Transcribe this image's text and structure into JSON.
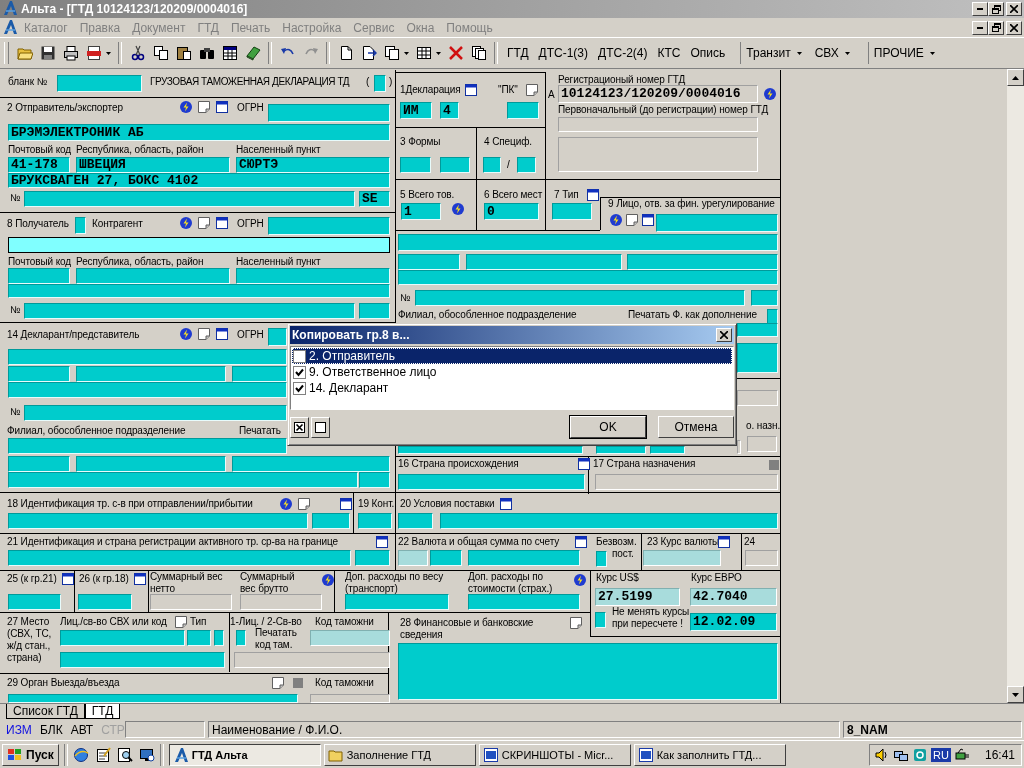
{
  "window": {
    "title": "Альта - [ГТД 10124123/120209/0004016]"
  },
  "menu": [
    {
      "label": "Каталог",
      "disabled": true
    },
    {
      "label": "Правка",
      "disabled": true
    },
    {
      "label": "Документ",
      "disabled": true
    },
    {
      "label": "ГТД",
      "disabled": true
    },
    {
      "label": "Печать",
      "disabled": true
    },
    {
      "label": "Настройка",
      "disabled": true
    },
    {
      "label": "Сервис",
      "disabled": true
    },
    {
      "label": "Окна",
      "disabled": true
    },
    {
      "label": "Помощь",
      "disabled": true
    }
  ],
  "toolbar": {
    "buttons": [
      {
        "label": "ГТД",
        "dropdown": false
      },
      {
        "label": "ДТС-1(3)",
        "dropdown": false
      },
      {
        "label": "ДТС-2(4)",
        "dropdown": false
      },
      {
        "label": "КТС",
        "dropdown": false
      },
      {
        "label": "Опись",
        "dropdown": false
      },
      {
        "label": "Транзит",
        "dropdown": true
      },
      {
        "label": "СВХ",
        "dropdown": true
      },
      {
        "label": "ПРОЧИЕ",
        "dropdown": true
      }
    ]
  },
  "form": {
    "labels": [
      "бланк №",
      "ГРУЗОВАЯ ТАМОЖЕННАЯ ДЕКЛАРАЦИЯ  ТД",
      "(",
      ")",
      "2 Отправитель/экспортер",
      "ОГРН",
      "Почтовый код",
      "Республика, область, район",
      "Населенный пункт",
      "№",
      "8 Получатель",
      "Контрагент",
      "ОГРН",
      "Почтовый код",
      "Республика, область, район",
      "Населенный пункт",
      "№",
      "14 Декларант/представитель",
      "ОГРН",
      "№",
      "Филиал, обособленное подразделение",
      "Печатать",
      "18 Идентификация тр. с-в при отправлении/прибытии",
      "19 Конт.",
      "21 Идентификация и страна регистрации активного тр. ср-ва на границе",
      "25 (к гр.21)",
      "26 (к гр.18)",
      "Суммарный вес нетто",
      "Суммарный вес брутто",
      "Доп. расходы по весу (транспорт)",
      "Доп. расходы по стоимости (страх.)",
      "Курс US$",
      "Курс ЕВРО",
      "Не менять курсы при пересчете !",
      "27  Место (СВХ, ТС, ж/д стан., страна)",
      "Лиц./св-во СВХ или код",
      "Тип",
      "1-Лиц. / 2-Св-во",
      "Печатать код там.",
      "Код таможни",
      "28 Финансовые и банковские сведения",
      "29 Орган Выезда/въезда",
      "Код таможни",
      "1Декларация",
      "\"ПК\"",
      "А",
      "Регистрационый номер ГТД",
      "Первоначальный (до регистрации) номер ГТД",
      "3 Формы",
      "4 Специф.",
      "/",
      "5 Всего тов.",
      "6 Всего мест",
      "7 Тип",
      "9 Лицо, отв. за фин. урегулирование",
      "№",
      "Филиал, обособленное подразделение",
      "Печатать Ф. как дополнение",
      "о. назн.",
      "16 Страна происхождения",
      "17 Страна назначения",
      "20 Условия поставки",
      "22 Валюта и общая сумма по счету",
      "Безвозм.",
      "пост.",
      "23 Курс валюты",
      "24"
    ],
    "fields": [
      {
        "text": "10124123/120209/0004016",
        "focused": false
      },
      {
        "text": "БРЭМЭЛЕКТРОНИК АБ",
        "focused": false
      },
      {
        "text": "41-178",
        "focused": false
      },
      {
        "text": "ШВЕЦИЯ",
        "focused": false
      },
      {
        "text": "СЮРТЭ",
        "focused": false
      },
      {
        "text": "БРУКСВАГЕН 27, БОКС 4102",
        "focused": false
      },
      {
        "text": "SE",
        "focused": false
      },
      {
        "focused": true
      },
      {
        "text": "ИМ",
        "focused": false
      },
      {
        "text": "4",
        "focused": false
      },
      {
        "text": "1",
        "focused": false
      },
      {
        "text": "0",
        "focused": false
      },
      {
        "text": "27.5199",
        "focused": false
      },
      {
        "text": "42.7040",
        "focused": false
      },
      {
        "text": "12.02.09",
        "focused": false
      }
    ]
  },
  "dialog": {
    "title": "Копировать гр.8 в...",
    "items": [
      {
        "label": "2. Отправитель",
        "checked": false,
        "selected": true
      },
      {
        "label": "9. Ответственное лицо",
        "checked": true,
        "selected": false
      },
      {
        "label": "14. Декларант",
        "checked": true,
        "selected": false
      }
    ],
    "buttons": [
      "OK",
      "Отмена"
    ]
  },
  "tabs": [
    {
      "label": "Список ГТД",
      "selected": false
    },
    {
      "label": "ГТД",
      "selected": true
    }
  ],
  "status_bar": {
    "modes": [
      {
        "label": "ИЗМ",
        "active": true,
        "disabled": false
      },
      {
        "label": "БЛК",
        "active": false,
        "disabled": false
      },
      {
        "label": "АВТ",
        "active": false,
        "disabled": false
      },
      {
        "label": "СТР",
        "active": false,
        "disabled": true
      }
    ],
    "hint": "Наименование / Ф.И.О.",
    "field": "8_NAM"
  },
  "taskbar": {
    "start": "Пуск",
    "tasks": [
      {
        "label": "ГТД Альта",
        "selected": true
      },
      {
        "label": "Заполнение ГТД",
        "selected": false
      },
      {
        "label": "СКРИНШОТЫ - Micr...",
        "selected": false
      },
      {
        "label": "Как заполнить ГТД...",
        "selected": false
      }
    ],
    "language": "RU",
    "clock": "16:41"
  }
}
